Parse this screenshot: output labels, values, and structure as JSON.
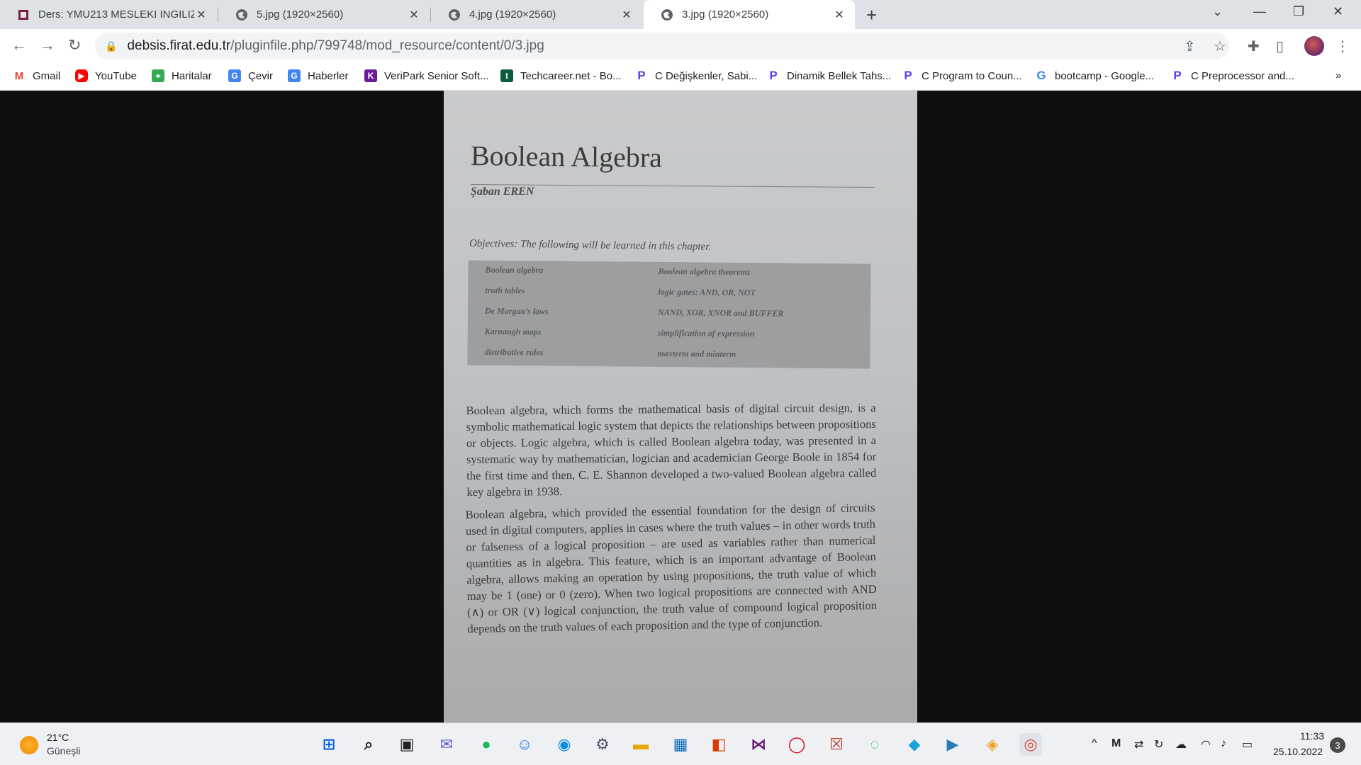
{
  "browser": {
    "tabs": [
      {
        "title": "Ders: YMU213 MESLEKI INGILIZCE",
        "active": false
      },
      {
        "title": "5.jpg (1920×2560)",
        "active": false
      },
      {
        "title": "4.jpg (1920×2560)",
        "active": false
      },
      {
        "title": "3.jpg (1920×2560)",
        "active": true
      }
    ],
    "url_host": "debsis.firat.edu.tr",
    "url_path": "/pluginfile.php/799748/mod_resource/content/0/3.jpg",
    "bookmarks": [
      {
        "label": "Gmail",
        "icon": "gmail-icon"
      },
      {
        "label": "YouTube",
        "icon": "youtube-icon"
      },
      {
        "label": "Haritalar",
        "icon": "maps-icon"
      },
      {
        "label": "Çevir",
        "icon": "translate-icon"
      },
      {
        "label": "Haberler",
        "icon": "news-icon"
      },
      {
        "label": "VeriPark Senior Soft...",
        "icon": "veripark-icon"
      },
      {
        "label": "Techcareer.net - Bo...",
        "icon": "techcareer-icon"
      },
      {
        "label": "C Değişkenler, Sabi...",
        "icon": "programiz-icon"
      },
      {
        "label": "Dinamik Bellek Tahs...",
        "icon": "programiz-icon"
      },
      {
        "label": "C Program to Coun...",
        "icon": "programiz-icon"
      },
      {
        "label": "bootcamp - Google...",
        "icon": "google-icon"
      },
      {
        "label": "C Preprocessor and...",
        "icon": "programiz-icon"
      }
    ],
    "more_bookmarks": "»"
  },
  "document": {
    "title": "Boolean Algebra",
    "author": "Şaban EREN",
    "objectives_heading": "Objectives: The following will be learned in this chapter.",
    "objectives_left": [
      "Boolean algebra",
      "truth tables",
      "De Morgan’s laws",
      "Karnaugh maps",
      "distributive rules"
    ],
    "objectives_right": [
      "Boolean algebra theorems",
      "logic gates: AND, OR, NOT",
      "NAND, XOR, XNOR and BUFFER",
      "simplification of expression",
      "maxterm and minterm"
    ],
    "paragraph1": "Boolean algebra, which forms the mathematical basis of digital circuit design, is a symbolic mathematical logic system that depicts the relationships between propositions or objects. Logic algebra, which is called Boolean algebra today, was presented in a systematic way by mathematician, logician and academician George Boole in 1854 for the first time and then, C. E. Shannon developed a two-valued Boolean algebra called key algebra in 1938.",
    "paragraph2": "Boolean algebra, which provided the essential foundation for the design of circuits used in digital computers, applies in cases where the truth values – in other words truth or falseness of a logical proposition – are used as variables rather than numerical quantities as in algebra. This feature, which is an important advantage of Boolean algebra, allows making an operation by using propositions, the truth value of which may be 1 (one) or 0 (zero). When two logical propositions are connected with AND (∧) or OR (∨) logical conjunction, the truth value of compound logical proposition depends on the truth values of each proposition and the type of conjunction."
  },
  "taskbar": {
    "temperature": "21°C",
    "condition": "Güneşli",
    "time": "11:33",
    "date": "25.10.2022",
    "notification_count": "3"
  }
}
